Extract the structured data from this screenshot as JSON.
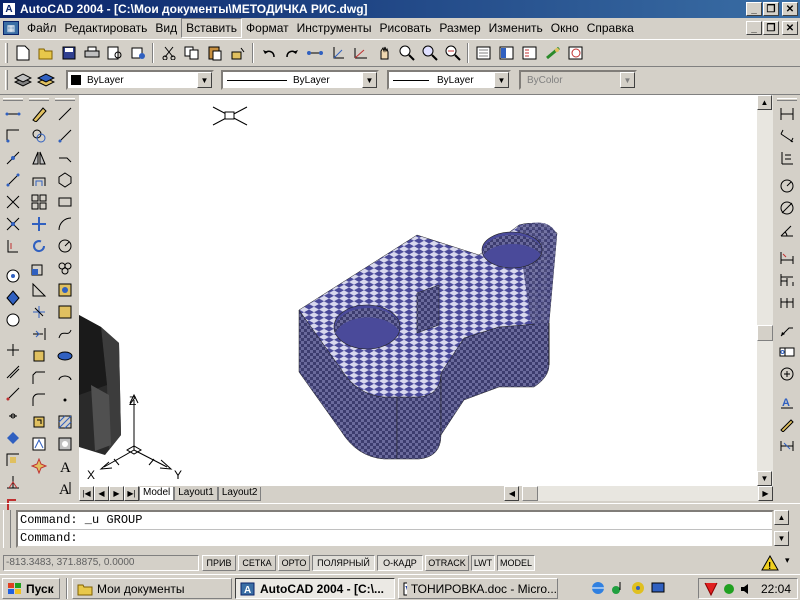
{
  "window": {
    "title": "AutoCAD 2004 - [C:\\Мои документы\\МЕТОДИЧКА РИС.dwg]",
    "app_icon": "A"
  },
  "menu": {
    "items": [
      "Файл",
      "Редактировать",
      "Вид",
      "Вставить",
      "Формат",
      "Инструменты",
      "Рисовать",
      "Размер",
      "Изменить",
      "Окно",
      "Справка"
    ],
    "selected": "Вставить"
  },
  "properties": {
    "color": "ByLayer",
    "linetype": "ByLayer",
    "lineweight": "ByLayer",
    "plotstyle": "ByColor"
  },
  "ucs": {
    "x_label": "X",
    "y_label": "Y",
    "z_label": "Z"
  },
  "layout_tabs": [
    "Model",
    "Layout1",
    "Layout2"
  ],
  "active_tab": "Model",
  "command_lines": [
    "Command:  _u GROUP",
    "Command:"
  ],
  "status": {
    "coords": "-813.3483, 371.8875, 0.0000",
    "buttons": [
      "ПРИВ",
      "СЕТКА",
      "ОРТО",
      "ПОЛЯРНЫЙ",
      "О-КАДР",
      "OTRACK",
      "LWT",
      "MODEL"
    ],
    "on": [
      "ПОЛЯРНЫЙ",
      "О-КАДР",
      "LWT",
      "MODEL"
    ]
  },
  "taskbar": {
    "start": "Пуск",
    "tasks": [
      "Мои документы",
      "AutoCAD 2004 - [C:\\...",
      "ТОНИРОВКА.doc - Micro..."
    ],
    "active": "AutoCAD 2004 - [C:\\...",
    "clock": "22:04"
  },
  "colors": {
    "title_start": "#0a246a",
    "title_end": "#3a6ea5",
    "checker_a": "#4a4a9a",
    "checker_b": "#d8d8ee",
    "solid_dark": "#2a2a2a"
  }
}
